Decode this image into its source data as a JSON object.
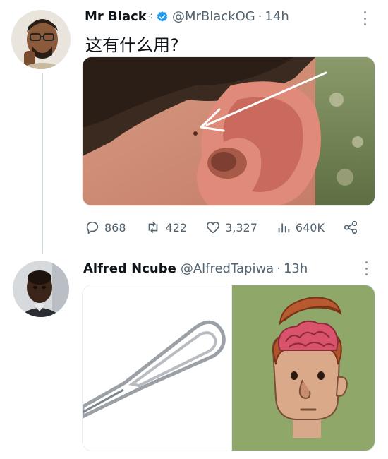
{
  "tweet1": {
    "name": "Mr Black",
    "name_suffix": "⁖",
    "handle": "@MrBlackOG",
    "separator": "·",
    "time": "14h",
    "text": "这有什么用?",
    "avatar_icon": "avatar-man-glasses",
    "verified_icon": "verified-badge",
    "media_description_icon": "ear-photo-with-arrow",
    "actions": {
      "replies": "868",
      "retweets": "422",
      "likes": "3,327",
      "views": "640K"
    }
  },
  "tweet2": {
    "name": "Alfred Ncube",
    "handle": "@AlfredTapiwa",
    "separator": "·",
    "time": "13h",
    "avatar_icon": "avatar-man",
    "media_left_icon": "sim-ejector-pin",
    "media_right_icon": "open-head-brain"
  },
  "colors": {
    "accent": "#1d9bf0",
    "text_primary": "#0f1419",
    "text_secondary": "#536471",
    "thread_line": "#cfd9de",
    "brain_bg": "#8fa86a"
  }
}
